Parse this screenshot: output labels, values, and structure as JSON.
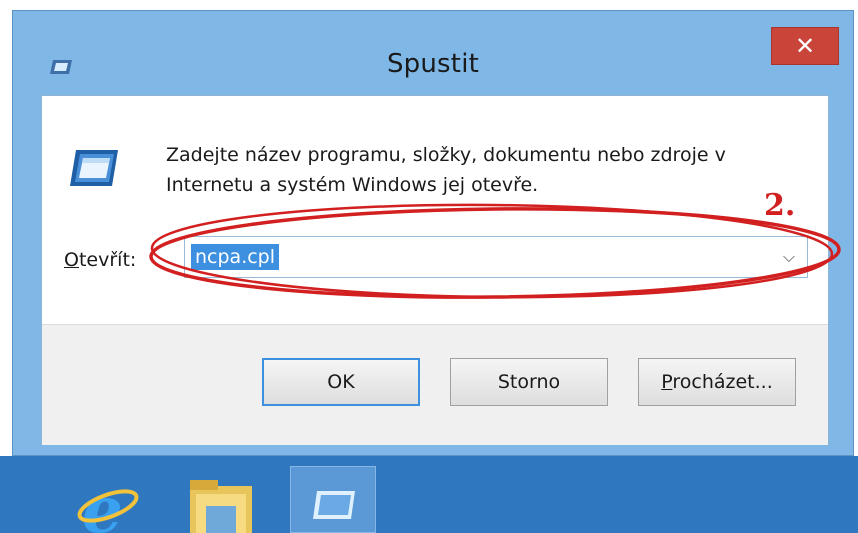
{
  "window": {
    "title": "Spustit",
    "close_glyph": "✕",
    "title_icon": "run-dialog-icon"
  },
  "dialog": {
    "icon": "run-program-icon",
    "description_line1": "Zadejte název programu, složky, dokumentu nebo zdroje v",
    "description_line2": "Internetu a systém Windows jej otevře.",
    "open_label_accel": "O",
    "open_label_rest": "tevřít:",
    "open_value": "ncpa.cpl",
    "dropdown_glyph": "⌵"
  },
  "annotation": {
    "step_number": "2.",
    "color": "#d21f1f"
  },
  "buttons": {
    "ok_label": "OK",
    "cancel_label": "Storno",
    "browse_accel": "P",
    "browse_rest": "rocházet..."
  },
  "taskbar": {
    "items": [
      {
        "icon": "internet-explorer-icon",
        "active": false
      },
      {
        "icon": "file-explorer-icon",
        "active": false
      },
      {
        "icon": "run-dialog-icon",
        "active": true
      }
    ]
  },
  "colors": {
    "window_frame": "#7fb7e6",
    "close_button": "#c9453a",
    "selection": "#3d8fe0",
    "taskbar": "#2f78c0"
  }
}
